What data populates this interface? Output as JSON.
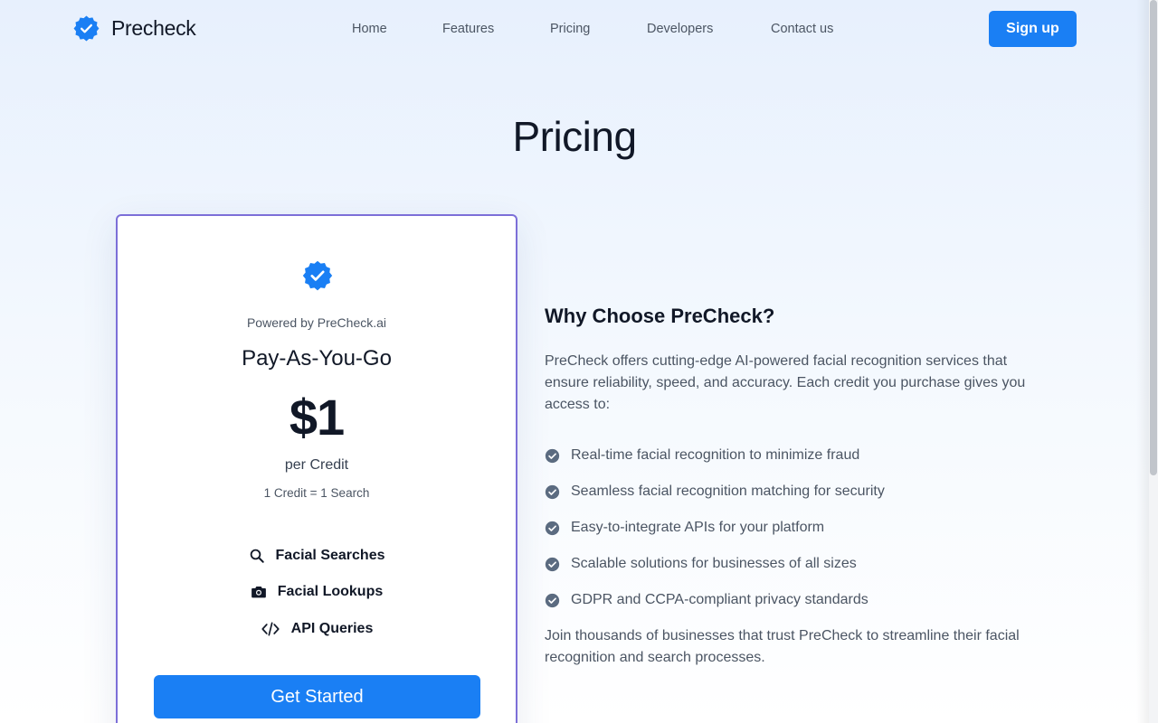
{
  "colors": {
    "accent": "#1a7ff4",
    "card_border": "#7c6fd8",
    "check_gray": "#5b6b80"
  },
  "header": {
    "brand": "Precheck",
    "brand_icon": "verified-badge-icon",
    "nav": [
      "Home",
      "Features",
      "Pricing",
      "Developers",
      "Contact us"
    ],
    "signup_label": "Sign up"
  },
  "page": {
    "title": "Pricing"
  },
  "card": {
    "badge_icon": "verified-badge-icon",
    "powered_by": "Powered by PreCheck.ai",
    "plan_name": "Pay-As-You-Go",
    "price": "$1",
    "per": "per Credit",
    "equivalence": "1 Credit = 1 Search",
    "features": [
      {
        "icon": "search-icon",
        "label": "Facial Searches"
      },
      {
        "icon": "camera-icon",
        "label": "Facial Lookups"
      },
      {
        "icon": "code-icon",
        "label": "API Queries"
      }
    ],
    "cta_label": "Get Started"
  },
  "why": {
    "title": "Why Choose PreCheck?",
    "intro": "PreCheck offers cutting-edge AI-powered facial recognition services that ensure reliability, speed, and accuracy. Each credit you purchase gives you access to:",
    "benefits": [
      "Real-time facial recognition to minimize fraud",
      "Seamless facial recognition matching for security",
      "Easy-to-integrate APIs for your platform",
      "Scalable solutions for businesses of all sizes",
      "GDPR and CCPA-compliant privacy standards"
    ],
    "outro": "Join thousands of businesses that trust PreCheck to streamline their facial recognition and search processes."
  }
}
